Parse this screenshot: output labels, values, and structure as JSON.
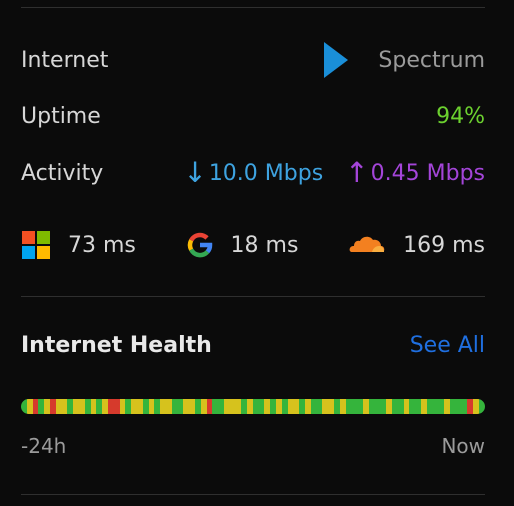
{
  "internet": {
    "label": "Internet",
    "isp": "Spectrum"
  },
  "uptime": {
    "label": "Uptime",
    "value": "94%"
  },
  "activity": {
    "label": "Activity",
    "download_arrow": "↓",
    "download": "10.0 Mbps",
    "upload_arrow": "↑",
    "upload": "0.45 Mbps"
  },
  "latency": [
    {
      "service": "microsoft-icon",
      "value": "73 ms"
    },
    {
      "service": "google-icon",
      "value": "18 ms"
    },
    {
      "service": "cloudflare-icon",
      "value": "169 ms"
    }
  ],
  "health": {
    "title": "Internet Health",
    "see_all": "See All",
    "start_label": "-24h",
    "end_label": "Now",
    "colors": {
      "good": "#35b43c",
      "warn": "#d6c21d",
      "bad": "#d63a2c"
    },
    "segments": [
      "g",
      "w",
      "b",
      "g",
      "w",
      "b",
      "w",
      "w",
      "g",
      "w",
      "w",
      "g",
      "w",
      "g",
      "w",
      "b",
      "b",
      "w",
      "g",
      "w",
      "w",
      "g",
      "w",
      "g",
      "w",
      "w",
      "g",
      "g",
      "w",
      "w",
      "g",
      "w",
      "b",
      "g",
      "g",
      "w",
      "w",
      "w",
      "g",
      "w",
      "g",
      "g",
      "w",
      "g",
      "w",
      "g",
      "w",
      "w",
      "g",
      "w",
      "g",
      "g",
      "w",
      "w",
      "g",
      "w",
      "g",
      "g",
      "g",
      "w",
      "g",
      "g",
      "g",
      "w",
      "g",
      "g",
      "w",
      "g",
      "g",
      "w",
      "g",
      "g",
      "g",
      "w",
      "g",
      "g",
      "g",
      "b",
      "w",
      "g"
    ]
  }
}
